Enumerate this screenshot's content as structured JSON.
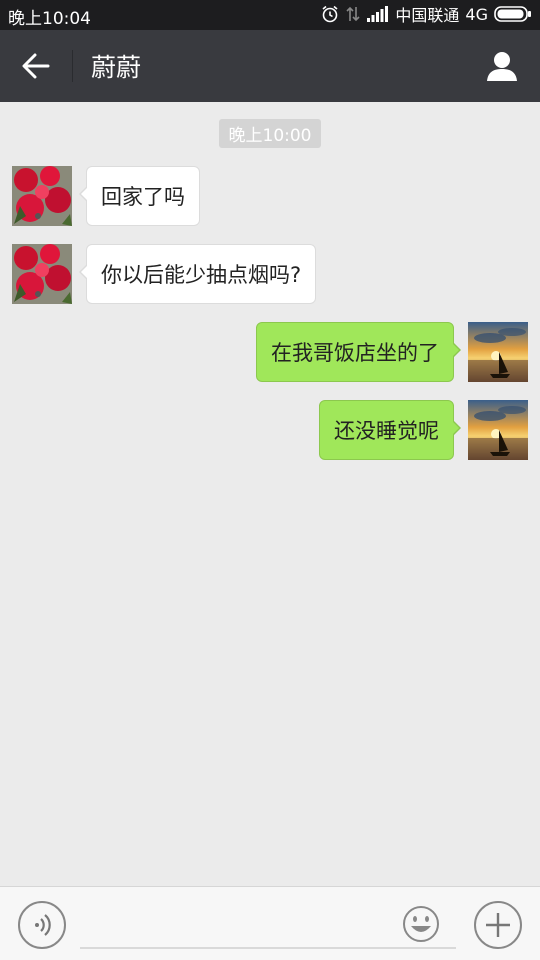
{
  "status_bar": {
    "time": "晚上10:04",
    "carrier": "中国联通",
    "network": "4G",
    "icons": [
      "alarm-icon",
      "data-arrows-icon",
      "signal-icon",
      "battery-icon"
    ]
  },
  "header": {
    "title": "蔚蔚",
    "back_icon": "back-arrow-icon",
    "profile_icon": "person-icon",
    "background_color": "#393a3f"
  },
  "chat": {
    "timestamp": "晚上10:00",
    "messages": [
      {
        "side": "left",
        "text": "回家了吗",
        "avatar": "red-flower-avatar"
      },
      {
        "side": "left",
        "text": "你以后能少抽点烟吗?",
        "avatar": "red-flower-avatar"
      },
      {
        "side": "right",
        "text": "在我哥饭店坐的了",
        "avatar": "sunset-boat-avatar"
      },
      {
        "side": "right",
        "text": "还没睡觉呢",
        "avatar": "sunset-boat-avatar"
      }
    ],
    "colors": {
      "received_bubble": "#ffffff",
      "sent_bubble": "#a0e75a",
      "background": "#ebebeb"
    }
  },
  "input_bar": {
    "voice_icon": "voice-icon",
    "input_value": "",
    "emoji_icon": "emoji-icon",
    "plus_icon": "plus-icon"
  }
}
